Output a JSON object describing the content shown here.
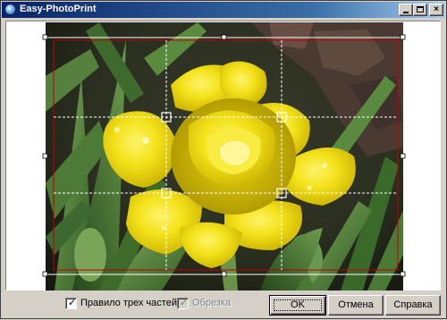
{
  "window": {
    "title": "Easy-PhotoPrint"
  },
  "title_buttons": {
    "minimize": "_",
    "maximize": "□",
    "close": "×"
  },
  "photo": {
    "description_icon": "yellow-tulip-photo"
  },
  "crop": {
    "frame_color": "#c00000",
    "guide_color": "#ffffff",
    "handle_color": "#ffffff"
  },
  "options": {
    "rule_of_thirds": {
      "label": "Правило трех частей",
      "checked": true,
      "enabled": true
    },
    "trimming": {
      "label": "Обрезка",
      "checked": true,
      "enabled": false
    }
  },
  "buttons": {
    "ok": "OK",
    "cancel": "Отмена",
    "help": "Справка"
  },
  "checkmark": "✓"
}
